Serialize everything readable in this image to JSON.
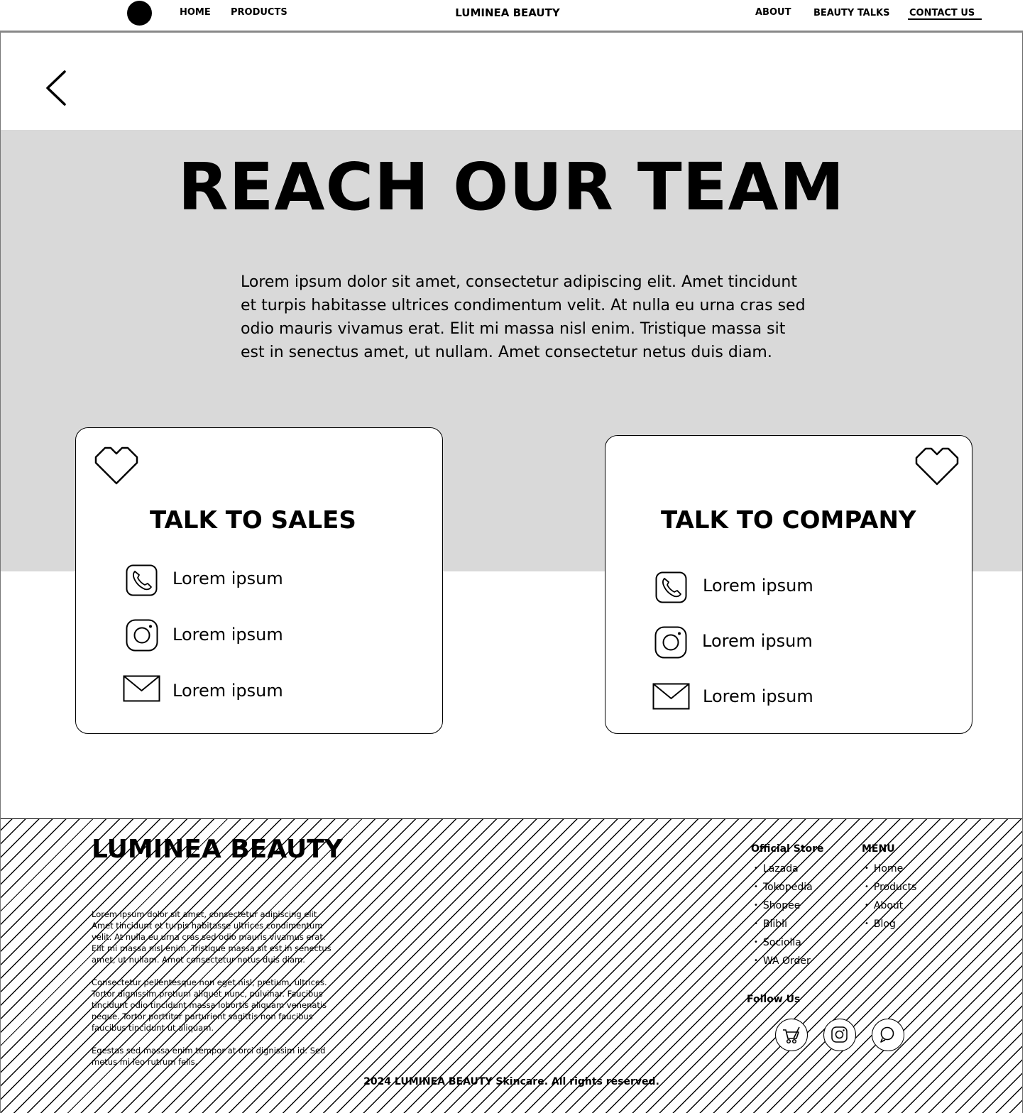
{
  "nav": {
    "home": "HOME",
    "products": "PRODUCTS",
    "brand": "LUMINEA BEAUTY",
    "about": "ABOUT",
    "beauty_talks": "BEAUTY TALKS",
    "contact": "CONTACT US"
  },
  "hero": {
    "title": "REACH OUR TEAM",
    "description": "Lorem ipsum dolor sit amet, consectetur adipiscing elit. Amet tincidunt et turpis habitasse ultrices condimentum velit. At nulla eu urna cras sed odio mauris vivamus erat. Elit mi massa nisl enim. Tristique massa sit est in senectus amet, ut nullam. Amet consectetur netus duis diam."
  },
  "cards": [
    {
      "title": "TALK TO SALES",
      "phone": "Lorem ipsum",
      "instagram": "Lorem ipsum",
      "email": "Lorem ipsum"
    },
    {
      "title": "TALK TO COMPANY",
      "phone": "Lorem ipsum",
      "instagram": "Lorem ipsum",
      "email": "Lorem ipsum"
    }
  ],
  "footer": {
    "brand": "LUMINEA BEAUTY",
    "para1": "Lorem ipsum dolor sit amet, consectetur adipiscing elit. Amet tincidunt et turpis habitasse ultrices condimentum velit. At nulla eu urna cras sed odio mauris vivamus erat. Elit mi massa nisl enim. Tristique massa sit est in senectus amet, ut nullam. Amet consectetur netus duis diam.",
    "para2": "Consectetur pellentesque non eget nisl, pretium, ultrices. Tortor dignissim pretium aliquet nunc, pulvinar. Faucibus tincidunt odio tincidunt massa lobortis aliquam venenatis neque. Tortor porttitor parturient sagittis non faucibus faucibus tincidunt ut aliquam.",
    "para3": "Egestas sed massa enim tempor at orci dignissim id. Sed metus mi leo rutrum felis.",
    "store_heading": "Official Store",
    "stores": [
      "Lazada",
      "Tokopedia",
      "Shopee",
      "Blibli",
      "Sociolla",
      "WA Order"
    ],
    "menu_heading": "MENU",
    "menu": [
      "Home",
      "Products",
      "About",
      "Blog"
    ],
    "follow_heading": "Follow Us",
    "social_icons": [
      "cart-icon",
      "instagram-icon",
      "chat-icon"
    ],
    "copyright": "2024 LUMINEA BEAUTY Skincare. All rights reserved."
  }
}
